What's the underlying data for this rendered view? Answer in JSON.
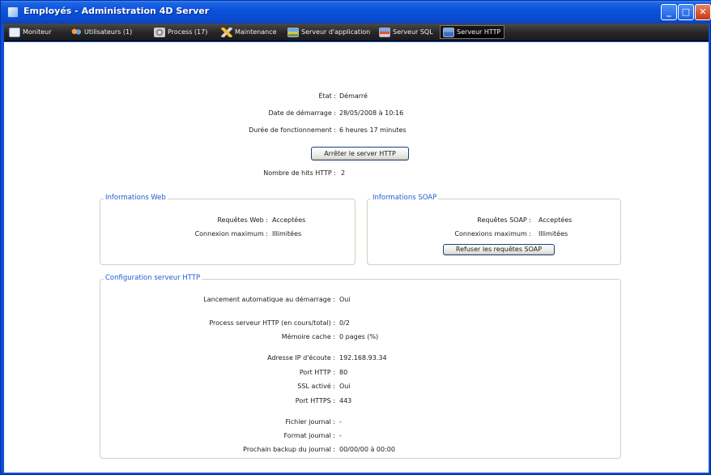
{
  "window": {
    "title": "Employés - Administration 4D Server",
    "controls": {
      "minimize": "_",
      "maximize": "□",
      "close": "✕"
    }
  },
  "toolbar": {
    "tabs": [
      {
        "label": "Moniteur",
        "icon": "monitor-icon"
      },
      {
        "label": "Utilisateurs (1)",
        "icon": "users-icon"
      },
      {
        "label": "Process (17)",
        "icon": "process-gear-icon"
      },
      {
        "label": "Maintenance",
        "icon": "maintenance-tools-icon"
      },
      {
        "label": "Serveur d'application",
        "icon": "application-server-icon"
      },
      {
        "label": "Serveur SQL",
        "icon": "sql-server-icon"
      },
      {
        "label": "Serveur HTTP",
        "icon": "http-server-icon",
        "active": true
      }
    ]
  },
  "status": {
    "etat_label": "État :",
    "etat_value": "Démarré",
    "start_label": "Date de démarrage :",
    "start_value": "28/05/2008 à 10:16",
    "uptime_label": "Durée de fonctionnement :",
    "uptime_value": "6 heures 17 minutes",
    "stop_button": "Arrêter le server HTTP",
    "hits_label": "Nombre de hits HTTP :",
    "hits_value": "2"
  },
  "web_info": {
    "title": "Informations Web",
    "requests_label": "Requêtes Web :",
    "requests_value": "Acceptées",
    "max_conn_label": "Connexion maximum :",
    "max_conn_value": "Illimitées"
  },
  "soap_info": {
    "title": "Informations SOAP",
    "requests_label": "Requêtes SOAP :",
    "requests_value": "Acceptées",
    "max_conn_label": "Connexions maximum :",
    "max_conn_value": "Illimitées",
    "refuse_button": "Refuser les requêtes SOAP"
  },
  "config": {
    "title": "Configuration serveur HTTP",
    "autostart_label": "Lancement automatique au démarrage :",
    "autostart_value": "Oui",
    "processes_label": "Process serveur HTTP (en cours/total) :",
    "processes_value": "0/2",
    "cache_label": "Mémoire cache :",
    "cache_value": "0 pages (%)",
    "ip_label": "Adresse IP d'écoute :",
    "ip_value": "192.168.93.34",
    "http_port_label": "Port HTTP :",
    "http_port_value": "80",
    "ssl_label": "SSL activé :",
    "ssl_value": "Oui",
    "https_port_label": "Port HTTPS :",
    "https_port_value": "443",
    "log_file_label": "Fichier journal :",
    "log_file_value": "-",
    "log_format_label": "Format journal :",
    "log_format_value": "-",
    "next_backup_label": "Prochain backup du journal :",
    "next_backup_value": "00/00/00 à 00:00"
  }
}
